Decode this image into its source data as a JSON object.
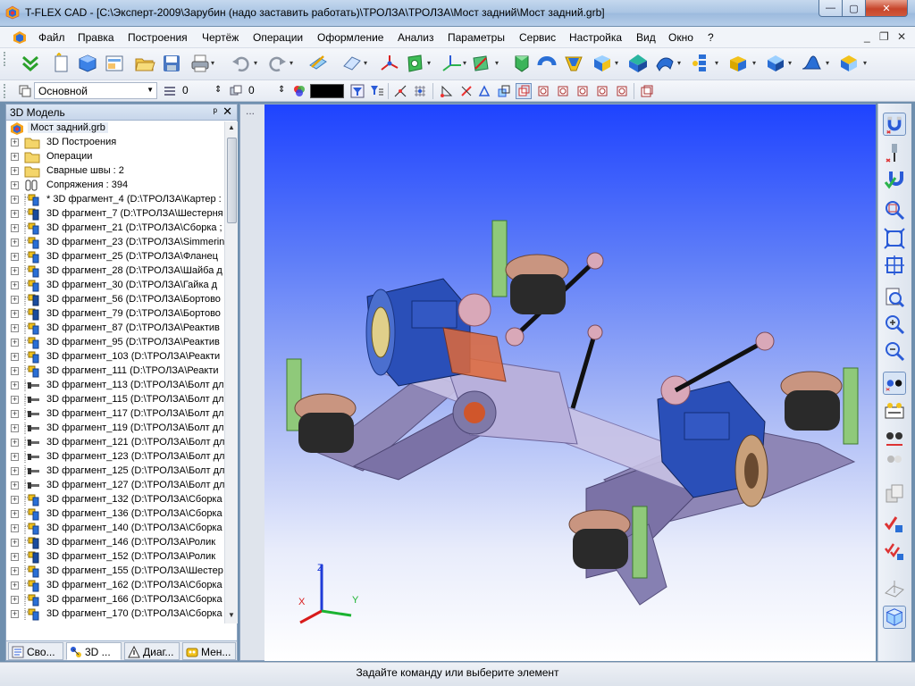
{
  "window": {
    "title": "T-FLEX CAD - [C:\\Эксперт-2009\\Зарубин (надо заставить работать)\\ТРОЛЗА\\ТРОЛЗА\\Мост задний\\Мост задний.grb]",
    "min": "—",
    "max": "▢",
    "close": "✕"
  },
  "menu": {
    "items": [
      "Файл",
      "Правка",
      "Построения",
      "Чертёж",
      "Операции",
      "Оформление",
      "Анализ",
      "Параметры",
      "Сервис",
      "Настройка",
      "Вид",
      "Окно",
      "?"
    ],
    "mdi_min": "_",
    "mdi_restore": "❐",
    "mdi_close": "✕"
  },
  "toolbar2": {
    "layer": "Основной",
    "level_value": "0",
    "priority_value": "0",
    "color": "#000000"
  },
  "left_panel": {
    "title": "3D Модель",
    "pin": "ᵖ",
    "close": "✕",
    "root": "Мост задний.grb",
    "items": [
      {
        "icon": "folder",
        "label": "3D Построения"
      },
      {
        "icon": "folder",
        "label": "Операции"
      },
      {
        "icon": "folder",
        "label": "Сварные швы : 2"
      },
      {
        "icon": "mates",
        "label": "Сопряжения : 394"
      },
      {
        "icon": "fragment-y",
        "label": "* 3D фрагмент_4 (D:\\ТРОЛЗА\\Картер :"
      },
      {
        "icon": "fragment-b",
        "label": "3D фрагмент_7 (D:\\ТРОЛЗА\\Шестерня"
      },
      {
        "icon": "fragment-y",
        "label": "3D фрагмент_21 (D:\\ТРОЛЗА\\Сборка ;"
      },
      {
        "icon": "fragment-y",
        "label": "3D фрагмент_23 (D:\\ТРОЛЗА\\Simmerin"
      },
      {
        "icon": "fragment-y",
        "label": "3D фрагмент_25 (D:\\ТРОЛЗА\\Фланец"
      },
      {
        "icon": "fragment-y",
        "label": "3D фрагмент_28 (D:\\ТРОЛЗА\\Шайба д"
      },
      {
        "icon": "fragment-y",
        "label": "3D фрагмент_30 (D:\\ТРОЛЗА\\Гайка д"
      },
      {
        "icon": "fragment-b",
        "label": "3D фрагмент_56 (D:\\ТРОЛЗА\\Бортово"
      },
      {
        "icon": "fragment-b",
        "label": "3D фрагмент_79 (D:\\ТРОЛЗА\\Бортово"
      },
      {
        "icon": "fragment-y",
        "label": "3D фрагмент_87 (D:\\ТРОЛЗА\\Реактив"
      },
      {
        "icon": "fragment-y",
        "label": "3D фрагмент_95 (D:\\ТРОЛЗА\\Реактив"
      },
      {
        "icon": "fragment-y",
        "label": "3D фрагмент_103 (D:\\ТРОЛЗА\\Реакти"
      },
      {
        "icon": "fragment-y",
        "label": "3D фрагмент_111 (D:\\ТРОЛЗА\\Реакти"
      },
      {
        "icon": "bolt",
        "label": "3D фрагмент_113 (D:\\ТРОЛЗА\\Болт дл"
      },
      {
        "icon": "bolt",
        "label": "3D фрагмент_115 (D:\\ТРОЛЗА\\Болт дл"
      },
      {
        "icon": "bolt",
        "label": "3D фрагмент_117 (D:\\ТРОЛЗА\\Болт дл"
      },
      {
        "icon": "bolt",
        "label": "3D фрагмент_119 (D:\\ТРОЛЗА\\Болт дл"
      },
      {
        "icon": "bolt",
        "label": "3D фрагмент_121 (D:\\ТРОЛЗА\\Болт дл"
      },
      {
        "icon": "bolt",
        "label": "3D фрагмент_123 (D:\\ТРОЛЗА\\Болт дл"
      },
      {
        "icon": "bolt",
        "label": "3D фрагмент_125 (D:\\ТРОЛЗА\\Болт дл"
      },
      {
        "icon": "bolt",
        "label": "3D фрагмент_127 (D:\\ТРОЛЗА\\Болт дл"
      },
      {
        "icon": "fragment-y",
        "label": "3D фрагмент_132 (D:\\ТРОЛЗА\\Сборка"
      },
      {
        "icon": "fragment-y",
        "label": "3D фрагмент_136 (D:\\ТРОЛЗА\\Сборка"
      },
      {
        "icon": "fragment-y",
        "label": "3D фрагмент_140 (D:\\ТРОЛЗА\\Сборка"
      },
      {
        "icon": "fragment-b",
        "label": "3D фрагмент_146 (D:\\ТРОЛЗА\\Ролик"
      },
      {
        "icon": "fragment-b",
        "label": "3D фрагмент_152 (D:\\ТРОЛЗА\\Ролик"
      },
      {
        "icon": "fragment-y",
        "label": "3D фрагмент_155 (D:\\ТРОЛЗА\\Шестер"
      },
      {
        "icon": "fragment-y",
        "label": "3D фрагмент_162 (D:\\ТРОЛЗА\\Сборка"
      },
      {
        "icon": "fragment-y",
        "label": "3D фрагмент_166 (D:\\ТРОЛЗА\\Сборка"
      },
      {
        "icon": "fragment-y",
        "label": "3D фрагмент_170 (D:\\ТРОЛЗА\\Сборка"
      }
    ],
    "tabs": [
      "Сво...",
      "3D ...",
      "Диаг...",
      "Мен..."
    ]
  },
  "viewport": {
    "dots": "...",
    "axes": {
      "x": "X",
      "y": "Y",
      "z": "Z"
    }
  },
  "status": "Задайте команду или выберите элемент"
}
